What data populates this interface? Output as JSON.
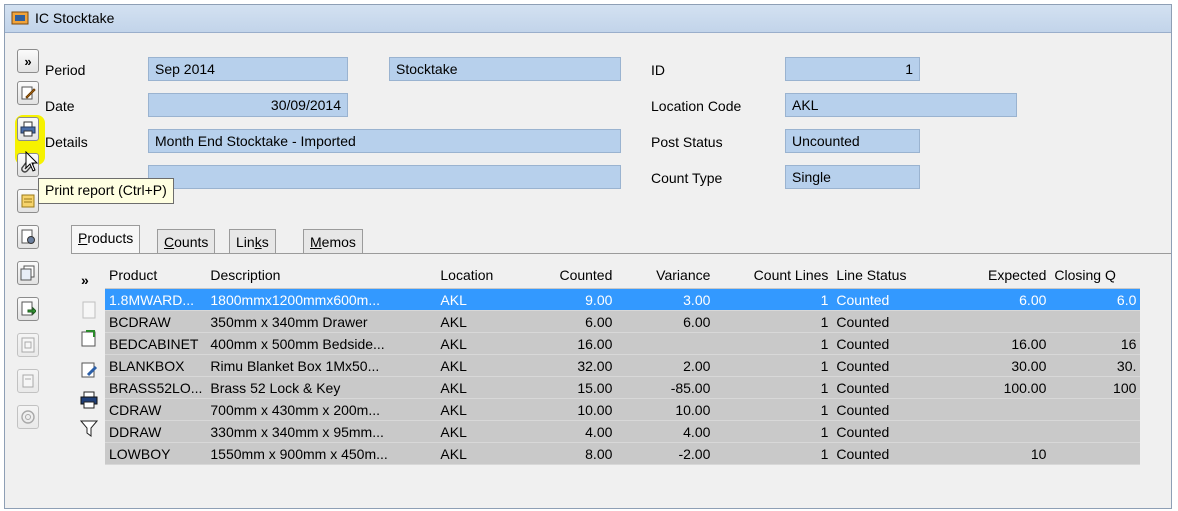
{
  "window": {
    "title": "IC Stocktake"
  },
  "header": {
    "period_label": "Period",
    "period_value": "Sep 2014",
    "type_value": "Stocktake",
    "id_label": "ID",
    "id_value": "1",
    "date_label": "Date",
    "date_value": "30/09/2014",
    "location_label": "Location Code",
    "location_value": "AKL",
    "details_label": "Details",
    "details_value": "Month End Stocktake - Imported",
    "post_status_label": "Post Status",
    "post_status_value": "Uncounted",
    "count_type_label": "Count Type",
    "count_type_value": "Single",
    "extra_value": ""
  },
  "tooltip": "Print report (Ctrl+P)",
  "tabs": [
    {
      "label": "Products",
      "accel": "P",
      "rest": "roducts"
    },
    {
      "label": "Counts",
      "accel": "C",
      "rest": "ounts"
    },
    {
      "label": "Links",
      "pre": "Lin",
      "accel": "k",
      "rest": "s"
    },
    {
      "label": "Memos",
      "accel": "M",
      "rest": "emos"
    }
  ],
  "grid": {
    "columns": [
      "Product",
      "Description",
      "Location",
      "Counted",
      "Variance",
      "Count Lines",
      "Line Status",
      "Expected",
      "Closing Q"
    ],
    "rows": [
      [
        "1.8MWARD...",
        "1800mmx1200mmx600m...",
        "AKL",
        "9.00",
        "3.00",
        "1",
        "Counted",
        "6.00",
        "6.0"
      ],
      [
        "BCDRAW",
        "350mm x 340mm Drawer",
        "AKL",
        "6.00",
        "6.00",
        "1",
        "Counted",
        "",
        ""
      ],
      [
        "BEDCABINET",
        "400mm x 500mm Bedside...",
        "AKL",
        "16.00",
        "",
        "1",
        "Counted",
        "16.00",
        "16"
      ],
      [
        "BLANKBOX",
        "Rimu Blanket Box 1Mx50...",
        "AKL",
        "32.00",
        "2.00",
        "1",
        "Counted",
        "30.00",
        "30."
      ],
      [
        "BRASS52LO...",
        "Brass 52 Lock & Key",
        "AKL",
        "15.00",
        "-85.00",
        "1",
        "Counted",
        "100.00",
        "100"
      ],
      [
        "CDRAW",
        "700mm x 430mm x 200m...",
        "AKL",
        "10.00",
        "10.00",
        "1",
        "Counted",
        "",
        ""
      ],
      [
        "DDRAW",
        "330mm x 340mm x 95mm...",
        "AKL",
        "4.00",
        "4.00",
        "1",
        "Counted",
        "",
        ""
      ],
      [
        "LOWBOY",
        "1550mm x 900mm x 450m...",
        "AKL",
        "8.00",
        "-2.00",
        "1",
        "Counted",
        "10",
        ""
      ]
    ]
  },
  "row_marker": "»",
  "expand_glyph": "»"
}
